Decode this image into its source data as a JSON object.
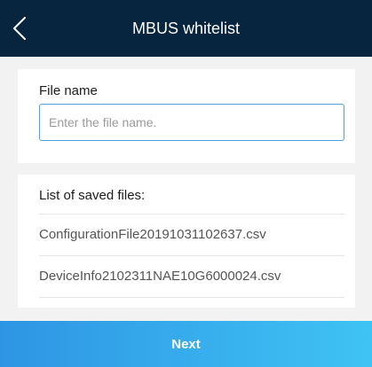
{
  "header": {
    "title": "MBUS whitelist",
    "back_icon": "chevron-left-icon"
  },
  "file_name": {
    "label": "File name",
    "value": "",
    "placeholder": "Enter the file name."
  },
  "saved_files": {
    "label": "List of saved files:",
    "items": [
      "ConfigurationFile20191031102637.csv",
      "DeviceInfo2102311NAE10G6000024.csv"
    ]
  },
  "footer": {
    "next_label": "Next"
  },
  "colors": {
    "header_bg": "#07253f",
    "accent": "#4da3e8",
    "button_gradient_start": "#2e95e4",
    "button_gradient_end": "#3fc3f4",
    "page_bg": "#f2f2f2"
  }
}
